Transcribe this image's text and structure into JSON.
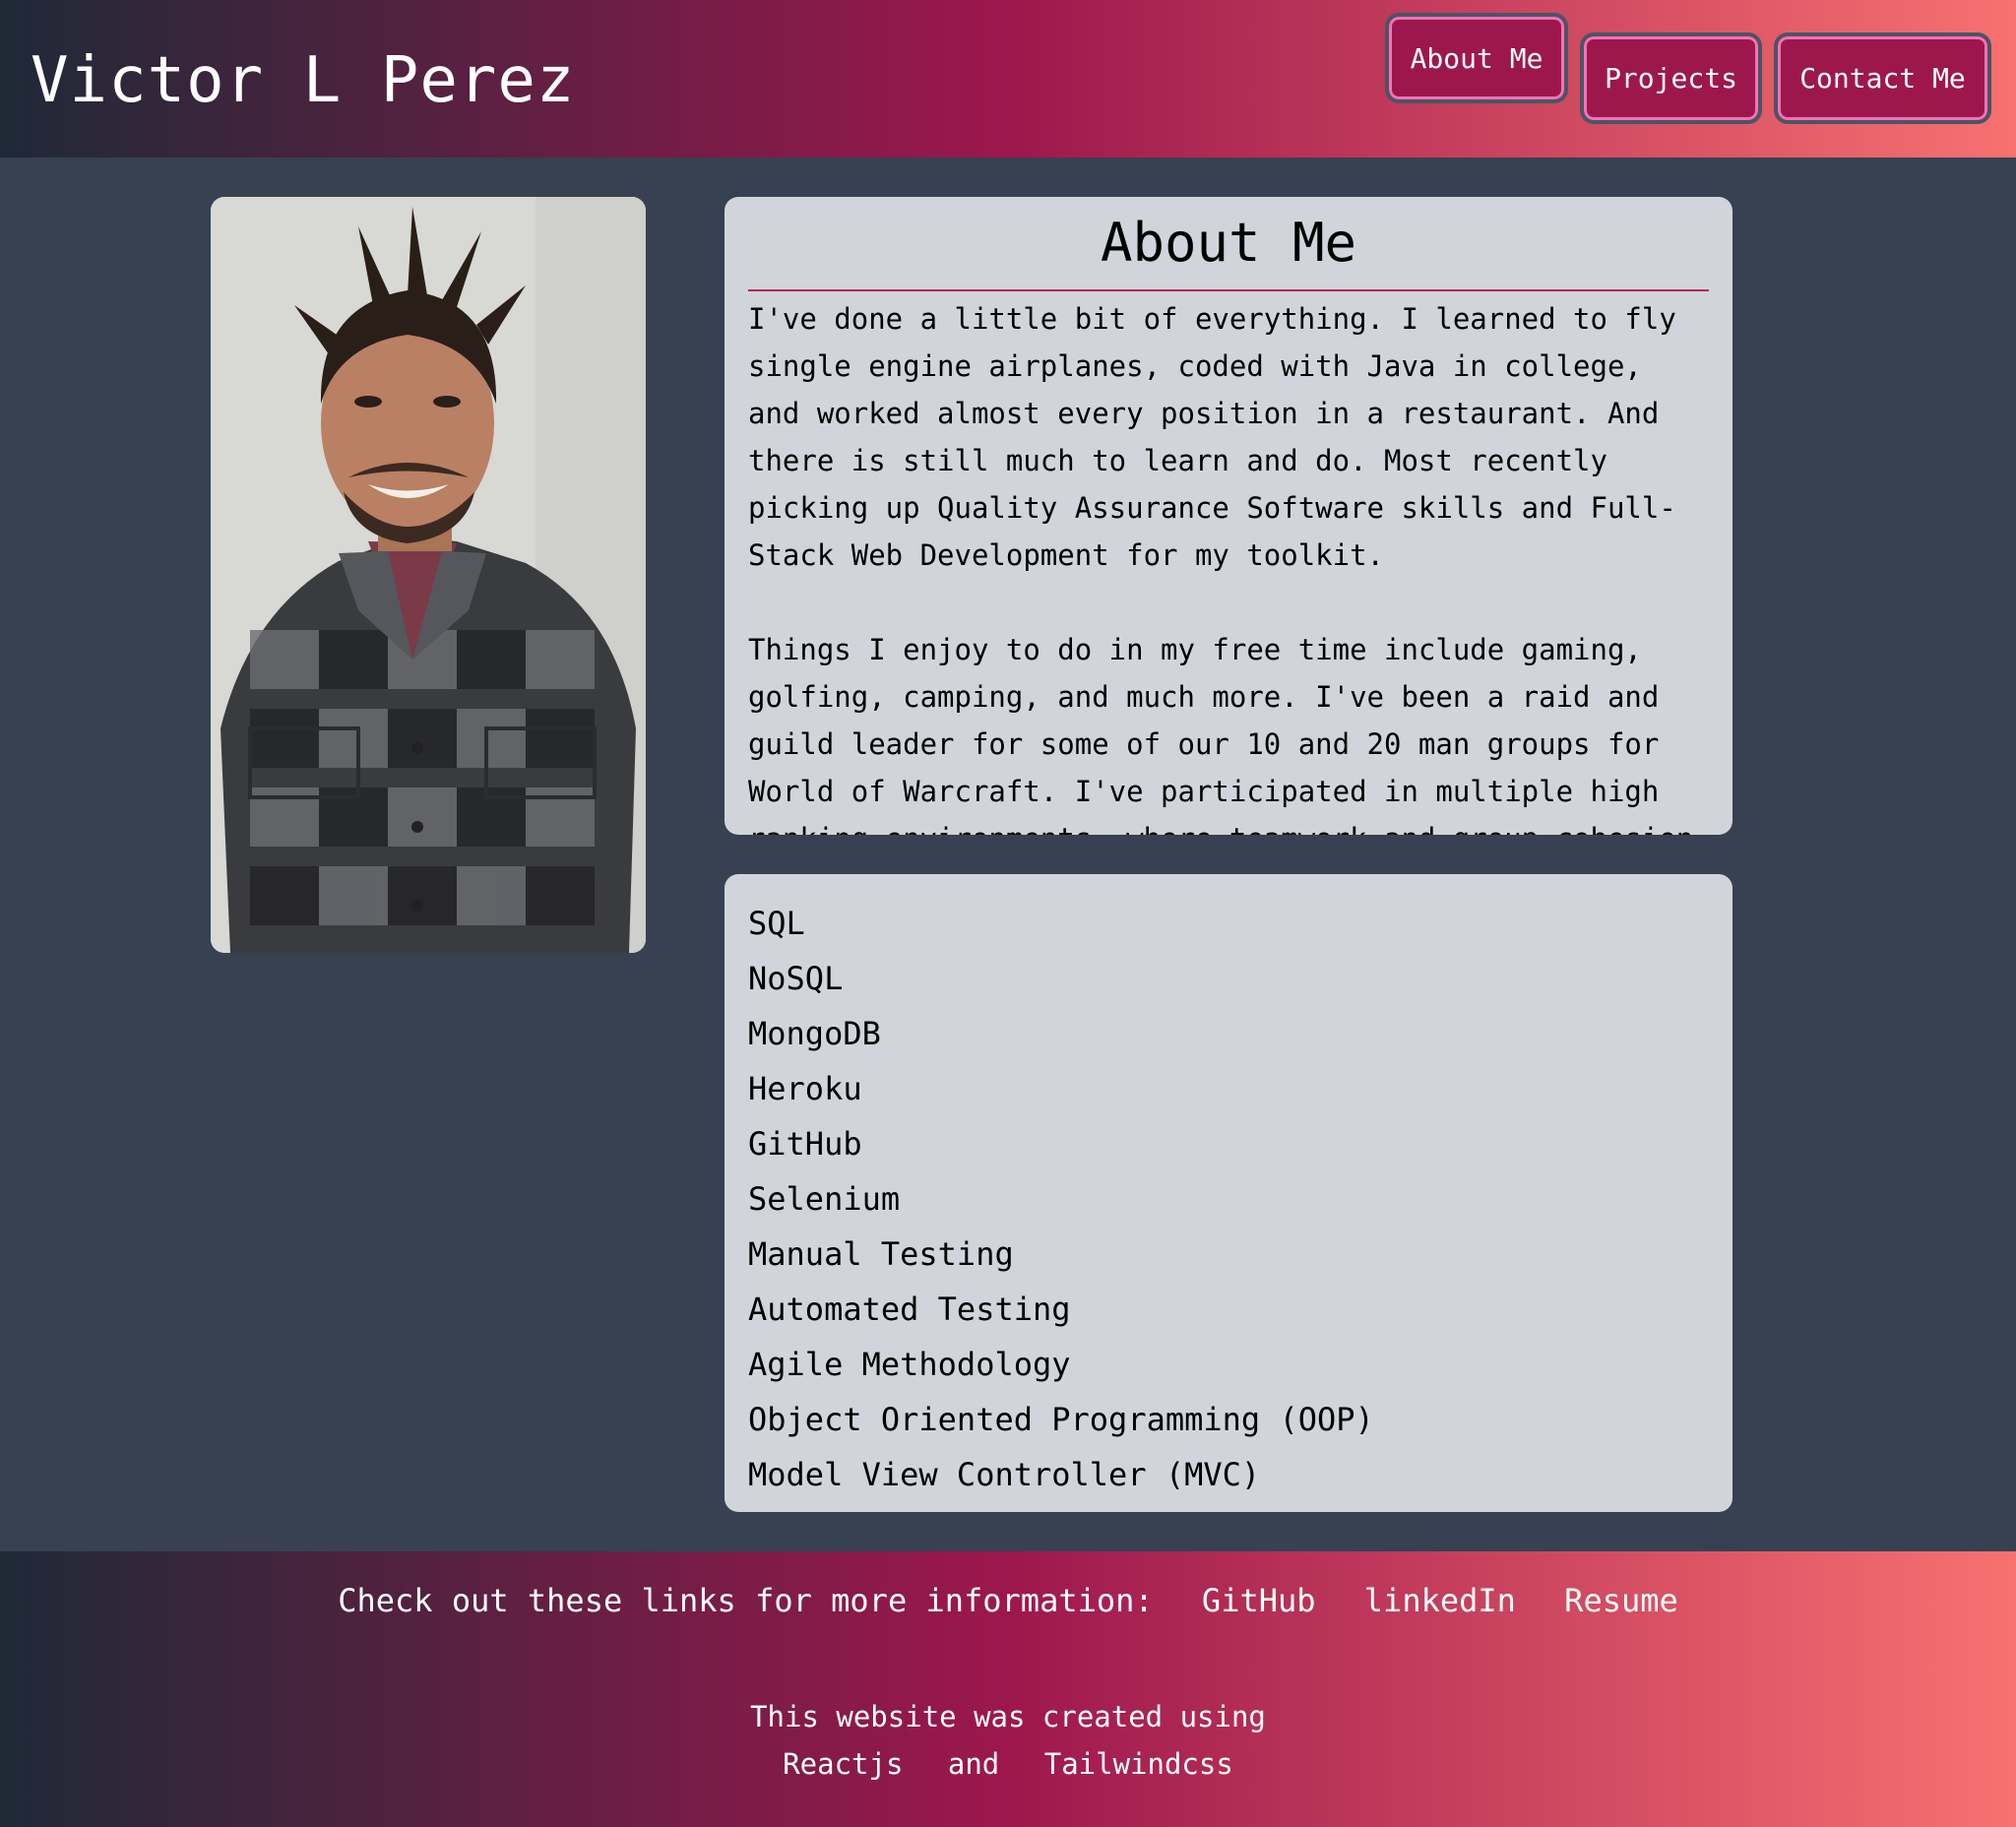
{
  "header": {
    "site_title": "Victor L Perez",
    "nav": {
      "about": "About Me",
      "projects": "Projects",
      "contact": "Contact Me"
    }
  },
  "about": {
    "heading": "About Me",
    "paragraph_1": "I've done a little bit of everything. I learned to fly single engine airplanes, coded with Java in college, and worked almost every position in a restaurant. And there is still much to learn and do. Most recently picking up Quality Assurance Software skills and Full-Stack Web Development for my toolkit.",
    "paragraph_2": "Things I enjoy to do in my free time include gaming, golfing, camping, and much more. I've been a raid and guild leader for some of our 10 and 20 man groups for World of Warcraft. I've participated in multiple high ranking environments, where teamwork and group cohesion"
  },
  "skills": [
    "SQL",
    "NoSQL",
    "MongoDB",
    "Heroku",
    "GitHub",
    "Selenium",
    "Manual Testing",
    "Automated Testing",
    "Agile Methodology",
    "Object Oriented Programming (OOP)",
    "Model View Controller (MVC)"
  ],
  "footer": {
    "links_intro": "Check out these links for more information:",
    "links": {
      "github": "GitHub",
      "linkedin": "linkedIn",
      "resume": "Resume"
    },
    "created_using": "This website was created using",
    "tech_1": "Reactjs",
    "and": "and",
    "tech_2": "Tailwindcss"
  },
  "colors": {
    "background": "#374151",
    "gradient_start": "#1f2937",
    "gradient_mid": "#9d174d",
    "gradient_end": "#f87171",
    "card": "#d1d5db",
    "button": "#9d174d",
    "divider": "#be185d"
  },
  "images": {
    "profile_photo": "portrait photo of man in plaid flannel shirt"
  }
}
